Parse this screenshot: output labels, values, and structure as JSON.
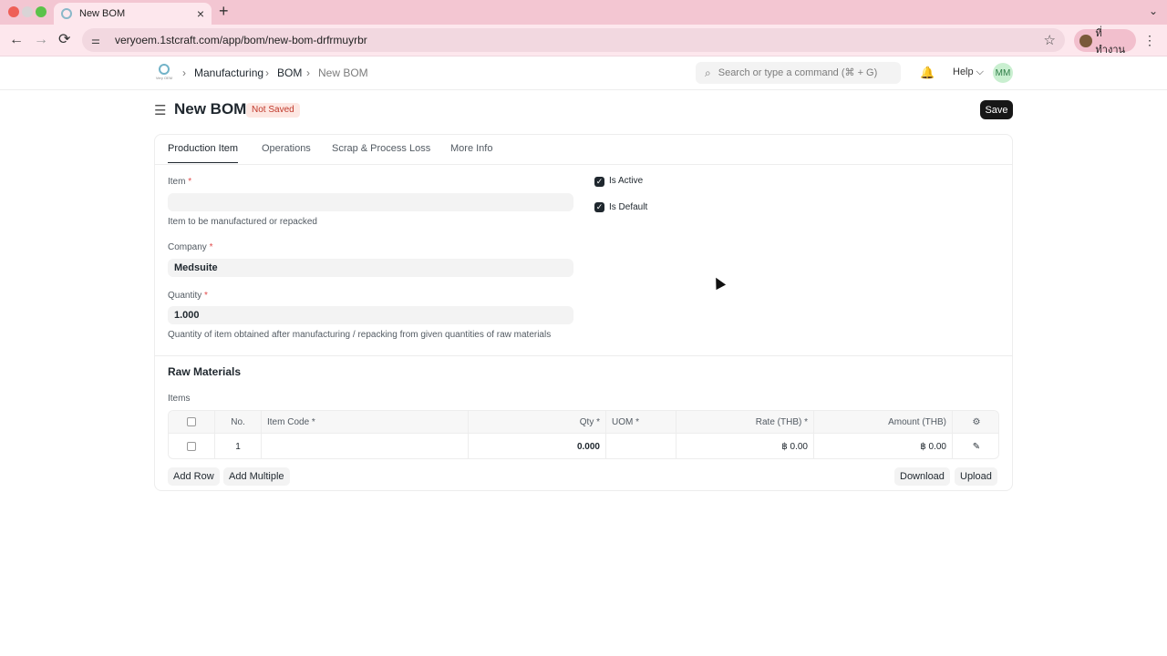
{
  "browser": {
    "tab_title": "New BOM",
    "new_tab_glyph": "+",
    "tab_menu_glyph": "⌄",
    "back_glyph": "←",
    "forward_glyph": "→",
    "reload_glyph": "⟳",
    "url": "veryoem.1stcraft.com/app/bom/new-bom-drfrmuyrbr",
    "star_glyph": "☆",
    "profile_label": "ที่ทำงาน",
    "menu_glyph": "⋮",
    "close_glyph": "×"
  },
  "navbar": {
    "logo_caption": "Very OEM",
    "breadcrumbs": [
      "Manufacturing",
      "BOM",
      "New BOM"
    ],
    "breadcrumb_separator": "›",
    "search_placeholder": "Search or type a command (⌘ + G)",
    "help_label": "Help ⌵",
    "avatar_initials": "MM",
    "bell_glyph": "🔔",
    "search_glyph": "⌕"
  },
  "page": {
    "hamburger_glyph": "☰",
    "title": "New BOM",
    "status": "Not Saved",
    "save_label": "Save"
  },
  "tabs": [
    "Production Item",
    "Operations",
    "Scrap & Process Loss",
    "More Info"
  ],
  "form": {
    "item_label": "Item",
    "item_value": "",
    "item_description": "Item to be manufactured or repacked",
    "company_label": "Company",
    "company_value": "Medsuite",
    "quantity_label": "Quantity",
    "quantity_value": "1.000",
    "quantity_description": "Quantity of item obtained after manufacturing / repacking from given quantities of raw materials",
    "required_marker": "*",
    "is_active_label": "Is Active",
    "is_active": true,
    "is_default_label": "Is Default",
    "is_default": true,
    "check_glyph": "✓"
  },
  "raw_materials": {
    "section_title": "Raw Materials",
    "items_label": "Items",
    "columns": {
      "no": "No.",
      "item_code": "Item Code *",
      "qty": "Qty *",
      "uom": "UOM *",
      "rate": "Rate (THB) *",
      "amount": "Amount (THB)"
    },
    "rows": [
      {
        "no": "1",
        "item_code": "",
        "qty": "0.000",
        "uom": "",
        "rate": "฿ 0.00",
        "amount": "฿ 0.00"
      }
    ],
    "settings_glyph": "⚙",
    "edit_glyph": "✎",
    "add_row_label": "Add Row",
    "add_multiple_label": "Add Multiple",
    "download_label": "Download",
    "upload_label": "Upload"
  }
}
